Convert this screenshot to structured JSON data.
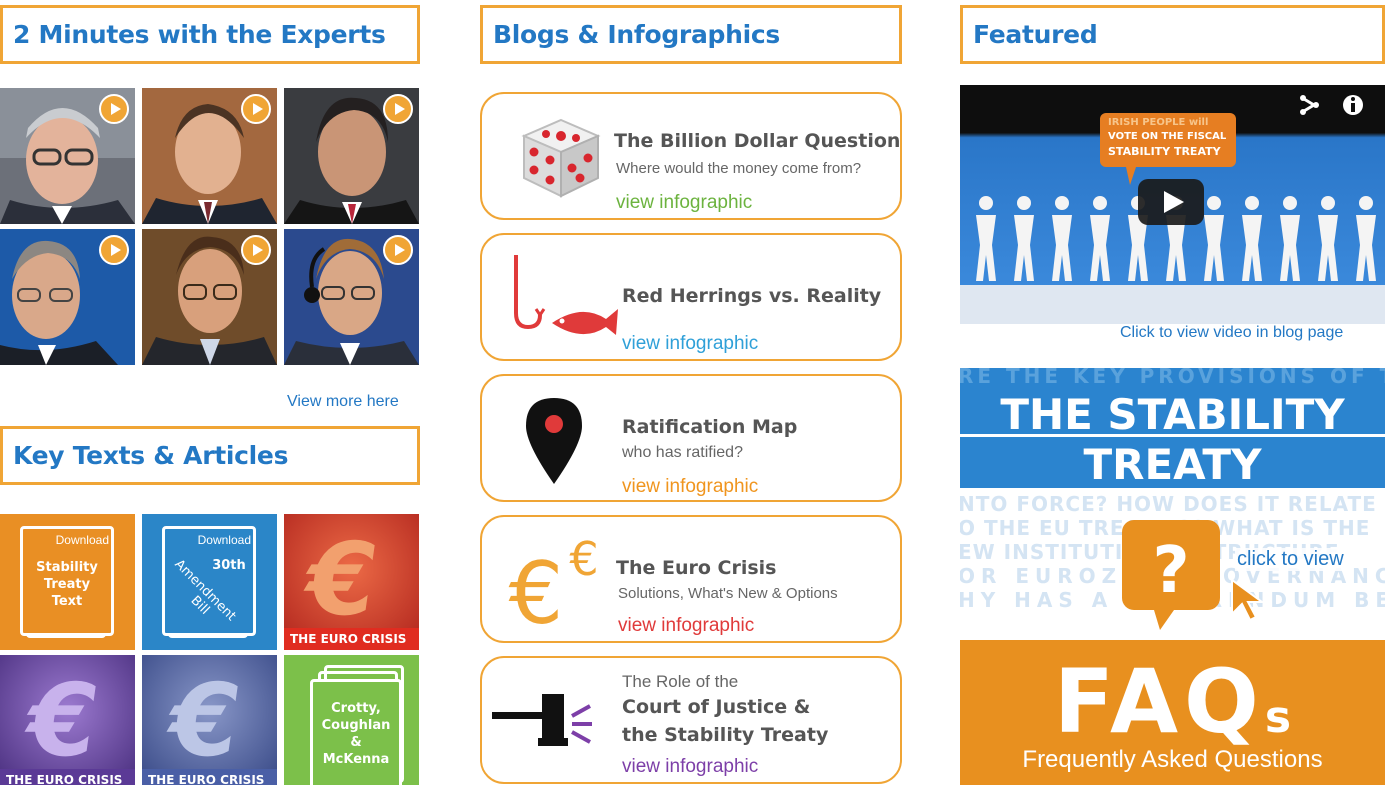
{
  "sections": {
    "experts_title": "2 Minutes with the Experts",
    "blogs_title": "Blogs & Infographics",
    "featured_title": "Featured",
    "keytexts_title": "Key Texts & Articles"
  },
  "experts": {
    "view_more": "View more here"
  },
  "key_texts": {
    "tiles": [
      {
        "download": "Download",
        "title": "Stability Treaty Text",
        "title_lines": [
          "Stability",
          "Treaty",
          "Text"
        ]
      },
      {
        "download": "Download",
        "title_lines": [
          "30th",
          "Amendment",
          "Bill"
        ]
      },
      {
        "caption": "THE EURO CRISIS"
      },
      {
        "caption": "THE EURO CRISIS"
      },
      {
        "caption": "THE EURO CRISIS"
      },
      {
        "title_lines": [
          "Crotty,",
          "Coughlan",
          "&",
          "McKenna"
        ]
      }
    ]
  },
  "infographics": [
    {
      "title": "The Billion Dollar Question",
      "subtitle": "Where would the money come from?",
      "link": "view infographic",
      "link_color": "#6cb33f"
    },
    {
      "title": "Red Herrings vs. Reality",
      "link": "view infographic",
      "link_color": "#2fa0d8"
    },
    {
      "title": "Ratification Map",
      "subtitle": "who has ratified?",
      "link": "view infographic",
      "link_color": "#f0951e"
    },
    {
      "title": "The Euro Crisis",
      "subtitle": "Solutions, What's New & Options",
      "link": "view infographic",
      "link_color": "#e03a3a"
    },
    {
      "pre": "The Role of the",
      "title": "Court of Justice &",
      "title2": "the Stability Treaty",
      "link": "view infographic",
      "link_color": "#7d3fa8"
    }
  ],
  "featured": {
    "video": {
      "overlay_line1": "IRISH PEOPLE will",
      "overlay_line2": "VOTE ON THE FISCAL",
      "overlay_line3": "STABILITY TREATY",
      "caption": "Click to view video in blog page"
    },
    "faq": {
      "bg_line1": "RE THE KEY PROVISIONS OF THE",
      "heading1": "THE STABILITY",
      "heading2": "TREATY",
      "bg_line2": "NTO FORCE? HOW DOES IT RELATE",
      "bg_line3": "O THE EU TREATIES? WHAT IS THE",
      "bg_line4": "EW INSTITUTIONAL STRUCTURE",
      "bg_line5": "OR EUROZONE GOVERNANCE?",
      "bg_line6": "HY HAS A REFERENDUM BEEN",
      "click_label": "click to view",
      "faq_big": "FAQ",
      "faq_s": "s",
      "faq_sub": "Frequently Asked Questions"
    }
  },
  "colors": {
    "accent": "#f0a535",
    "brand_blue": "#2378c4"
  }
}
